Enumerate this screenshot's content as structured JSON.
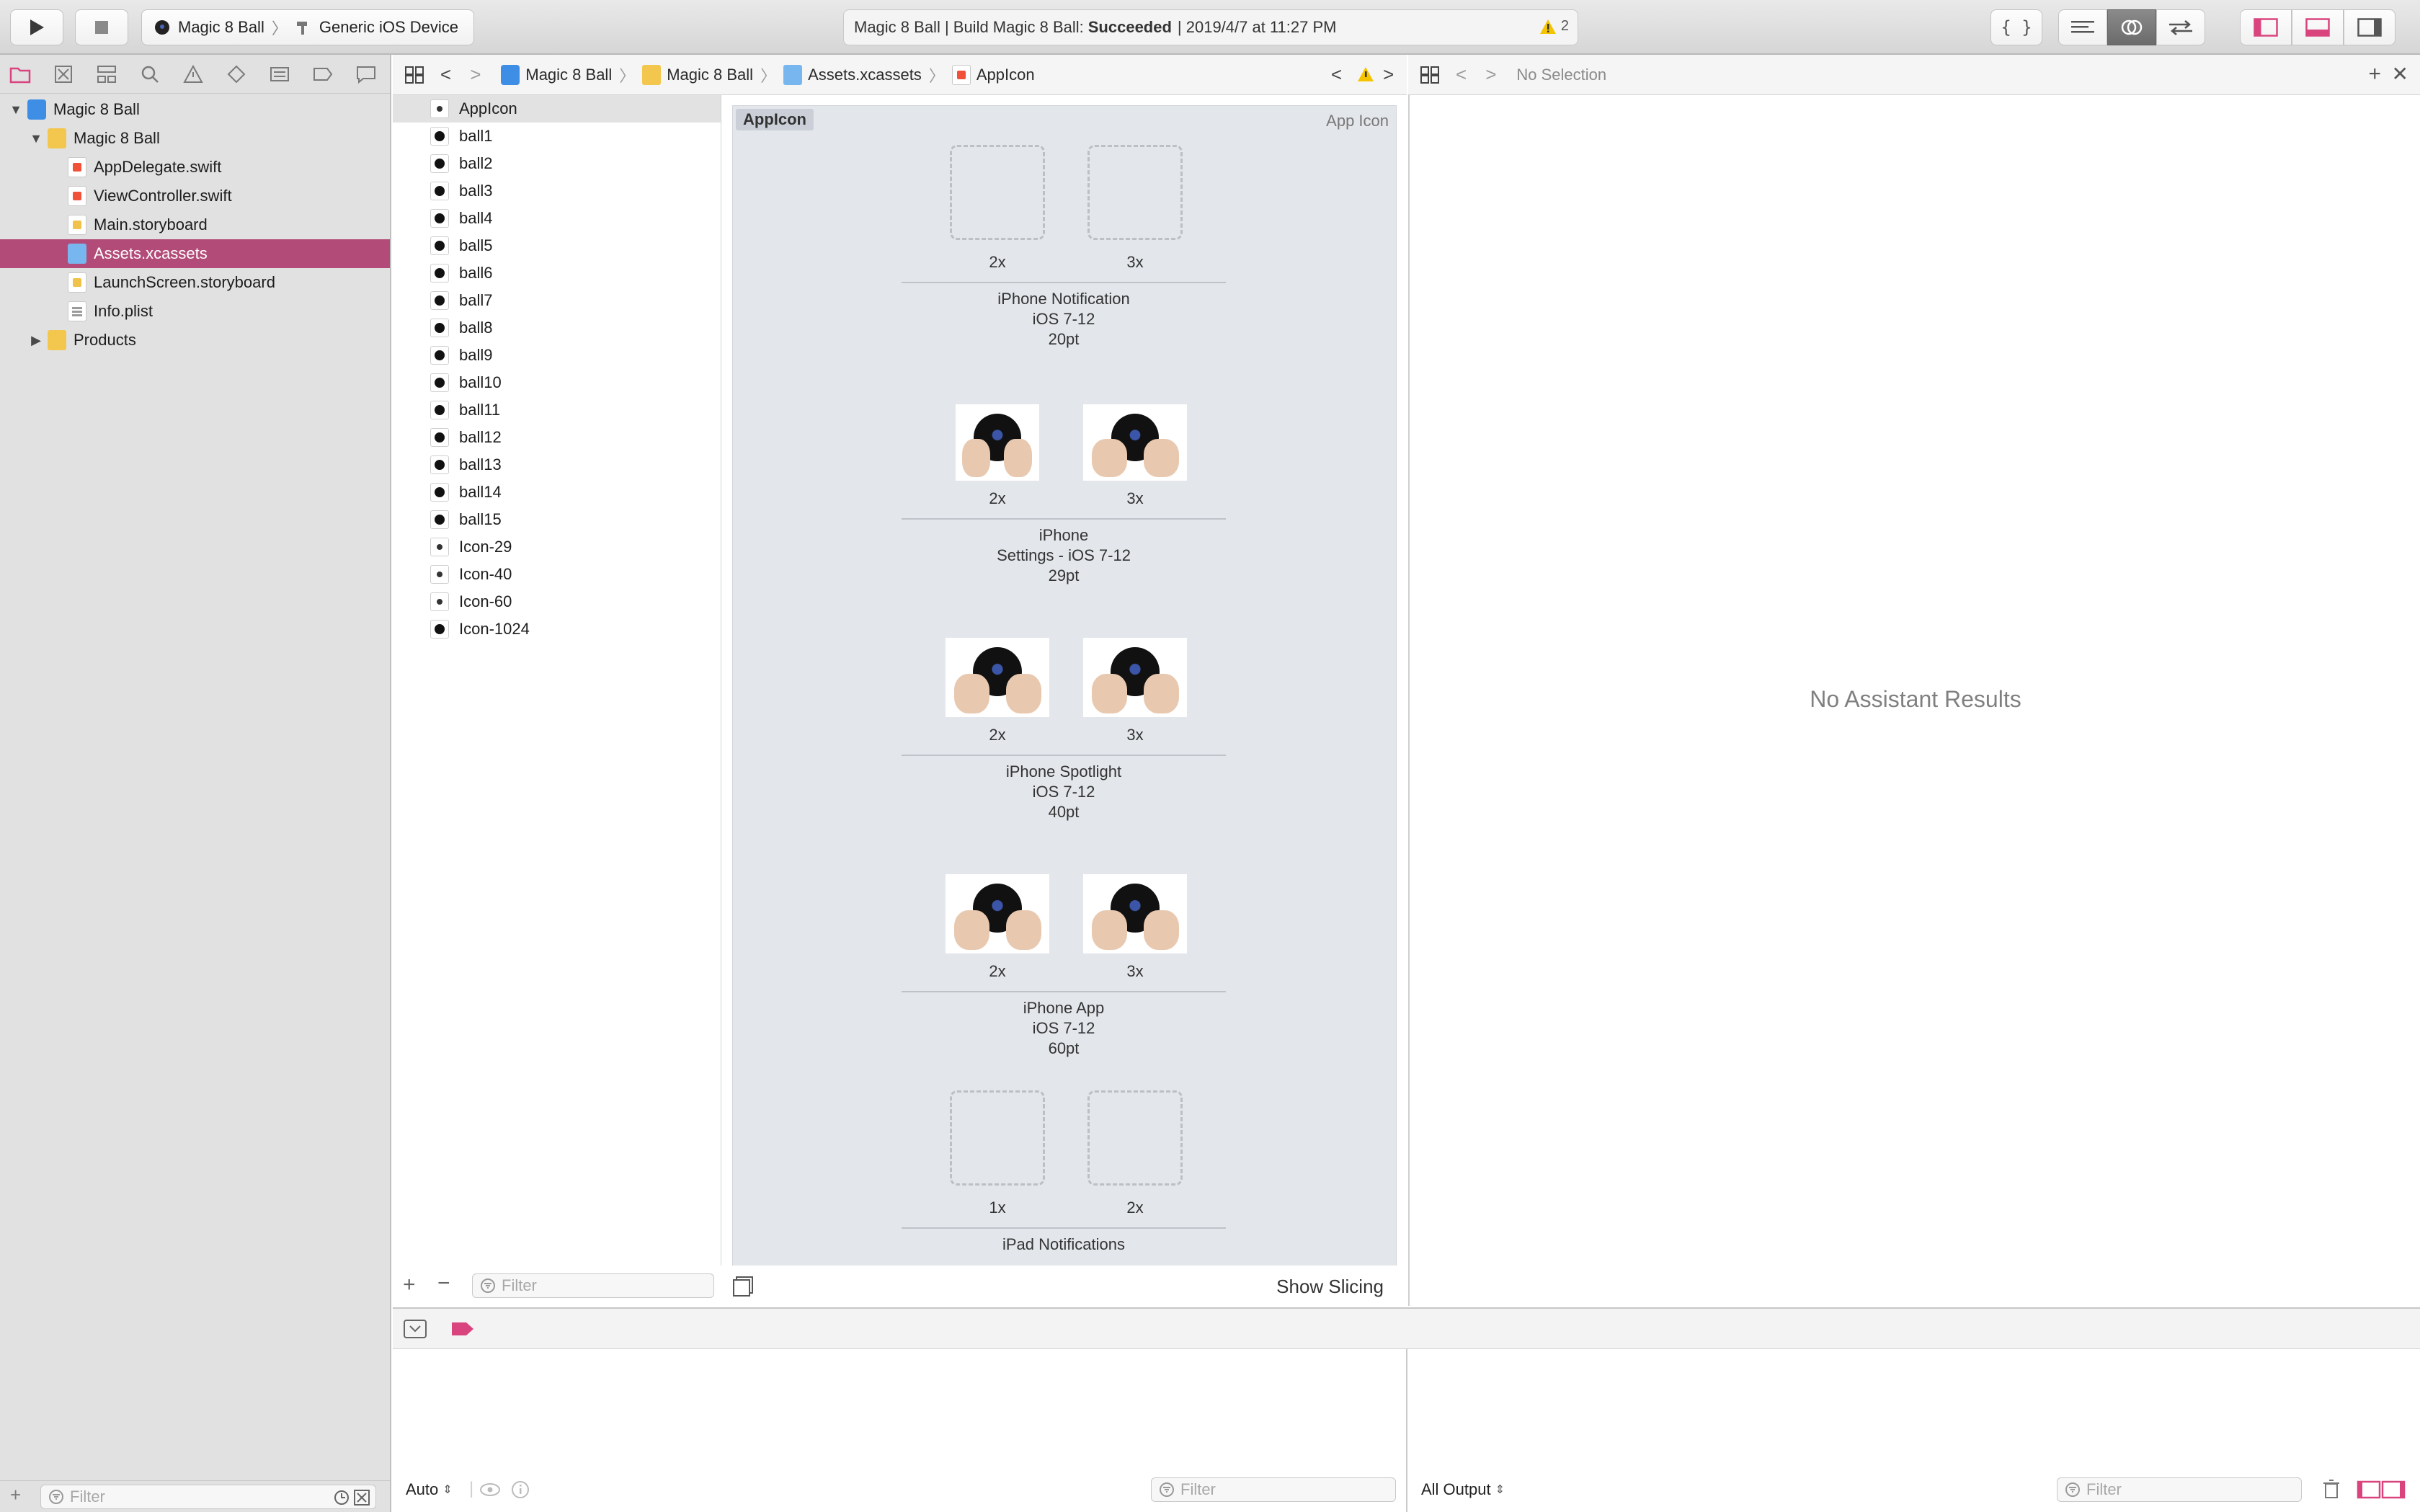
{
  "toolbar": {
    "scheme_app": "Magic 8 Ball",
    "scheme_device": "Generic iOS Device",
    "activity_prefix": "Magic 8 Ball | Build Magic 8 Ball: ",
    "activity_status": "Succeeded",
    "activity_time": "| 2019/4/7 at 11:27 PM",
    "warning_count": "2"
  },
  "navigator": {
    "tree": [
      {
        "label": "Magic 8 Ball",
        "kind": "project",
        "indent": 0,
        "disclosure": "▼"
      },
      {
        "label": "Magic 8 Ball",
        "kind": "folder",
        "indent": 1,
        "disclosure": "▼"
      },
      {
        "label": "AppDelegate.swift",
        "kind": "swift",
        "indent": 2,
        "disclosure": ""
      },
      {
        "label": "ViewController.swift",
        "kind": "swift",
        "indent": 2,
        "disclosure": ""
      },
      {
        "label": "Main.storyboard",
        "kind": "sb",
        "indent": 2,
        "disclosure": ""
      },
      {
        "label": "Assets.xcassets",
        "kind": "folder blue",
        "indent": 2,
        "disclosure": "",
        "selected": true
      },
      {
        "label": "LaunchScreen.storyboard",
        "kind": "sb",
        "indent": 2,
        "disclosure": ""
      },
      {
        "label": "Info.plist",
        "kind": "plist",
        "indent": 2,
        "disclosure": ""
      },
      {
        "label": "Products",
        "kind": "folder",
        "indent": 1,
        "disclosure": "▶"
      }
    ],
    "filter_placeholder": "Filter"
  },
  "jumpbar": {
    "crumbs": [
      "Magic 8 Ball",
      "Magic 8 Ball",
      "Assets.xcassets",
      "AppIcon"
    ]
  },
  "assistant": {
    "jump_label": "No Selection",
    "empty_message": "No Assistant Results"
  },
  "assets": {
    "items": [
      "AppIcon",
      "ball1",
      "ball2",
      "ball3",
      "ball4",
      "ball5",
      "ball6",
      "ball7",
      "ball8",
      "ball9",
      "ball10",
      "ball11",
      "ball12",
      "ball13",
      "ball14",
      "ball15",
      "Icon-29",
      "Icon-40",
      "Icon-60",
      "Icon-1024"
    ],
    "filter_placeholder": "Filter"
  },
  "editor": {
    "set_name": "AppIcon",
    "set_type": "App Icon",
    "show_slicing": "Show Slicing",
    "groups": [
      {
        "slots": [
          "2x",
          "3x"
        ],
        "filled": false,
        "lines": [
          "iPhone Notification",
          "iOS 7-12",
          "20pt"
        ]
      },
      {
        "slots": [
          "2x",
          "3x"
        ],
        "filled": true,
        "lines": [
          "iPhone",
          "Settings - iOS 7-12",
          "29pt"
        ]
      },
      {
        "slots": [
          "2x",
          "3x"
        ],
        "filled": true,
        "lines": [
          "iPhone Spotlight",
          "iOS 7-12",
          "40pt"
        ]
      },
      {
        "slots": [
          "2x",
          "3x"
        ],
        "filled": true,
        "lines": [
          "iPhone App",
          "iOS 7-12",
          "60pt"
        ]
      },
      {
        "slots": [
          "1x",
          "2x"
        ],
        "filled": false,
        "lines": [
          "iPad Notifications"
        ]
      }
    ]
  },
  "debug": {
    "variables_scope": "Auto",
    "console_scope": "All Output",
    "filter_placeholder": "Filter"
  },
  "colors": {
    "selection": "#b24b78",
    "accent_pink": "#d9447e",
    "warning": "#f5c400"
  }
}
